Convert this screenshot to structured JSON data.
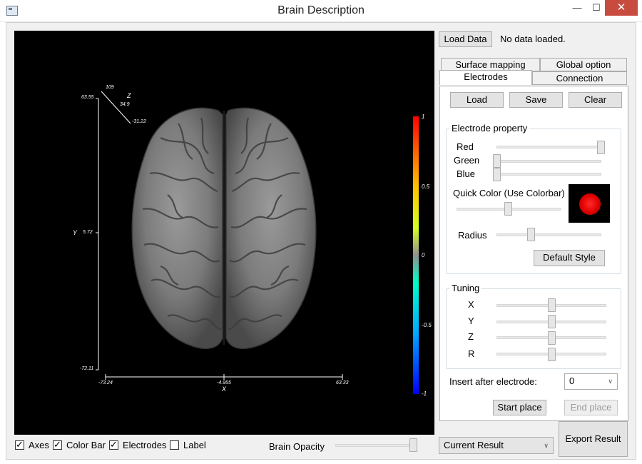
{
  "window": {
    "title": "Brain Description",
    "minimize_icon": "minimize-icon",
    "maximize_icon": "maximize-icon",
    "close_icon": "close-icon"
  },
  "viewer": {
    "background": "#000000",
    "axes": {
      "y_top": "63.55",
      "y_mid": "5.72",
      "y_bottom": "-72.11",
      "y_label": "Y",
      "x_left": "-73.24",
      "x_mid": "-4.955",
      "x_right": "63.33",
      "x_label": "X",
      "z_top": "109",
      "z_mid": "34.9",
      "z_bottom": "-31.22",
      "z_label": "Z"
    },
    "colorbar": {
      "ticks": [
        "1",
        "0.5",
        "0",
        "-0.5",
        "-1"
      ],
      "colors": [
        "#ff0000",
        "#ffbf00",
        "#c8ff00",
        "#808080",
        "#00ffc0",
        "#00a0ff",
        "#0000ff"
      ]
    }
  },
  "toolbar": {
    "load_data": "Load Data",
    "status": "No data loaded."
  },
  "tabs": {
    "surface_mapping": "Surface mapping",
    "global_option": "Global option",
    "electrodes": "Electrodes",
    "connection": "Connection"
  },
  "electrodes": {
    "load": "Load",
    "save": "Save",
    "clear": "Clear",
    "property_title": "Electrode property",
    "red": "Red",
    "green": "Green",
    "blue": "Blue",
    "quick_color": "Quick Color (Use Colorbar)",
    "radius": "Radius",
    "default_style": "Default Style",
    "tuning_title": "Tuning",
    "x": "X",
    "y": "Y",
    "z": "Z",
    "r": "R",
    "insert_after": "Insert after electrode:",
    "insert_value": "0",
    "start_place": "Start place",
    "end_place": "End place",
    "red_level": 1.0,
    "green_level": 0.0,
    "blue_level": 0.0,
    "quick_color_level": 0.5,
    "radius_level": 0.3,
    "tuning_levels": [
      0.5,
      0.5,
      0.5,
      0.5
    ],
    "preview_color": "#ff0000"
  },
  "bottom": {
    "axes": "Axes",
    "color_bar": "Color Bar",
    "electrodes": "Electrodes",
    "label": "Label",
    "axes_checked": true,
    "color_bar_checked": true,
    "electrodes_checked": true,
    "label_checked": false,
    "brain_opacity": "Brain Opacity",
    "opacity_level": 1.0,
    "result_select": "Current Result",
    "export": "Export Result"
  }
}
